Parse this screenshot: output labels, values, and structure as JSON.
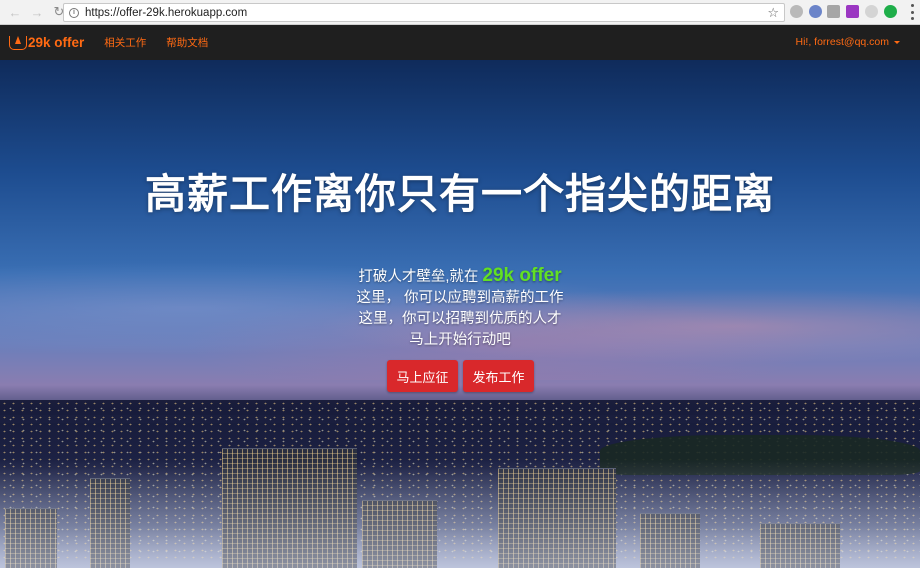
{
  "browser": {
    "url": "https://offer-29k.herokuapp.com",
    "icons": [
      "back-arrow-icon",
      "forward-arrow-icon",
      "reload-icon",
      "info-icon",
      "star-icon",
      "menu-dots-icon"
    ]
  },
  "navbar": {
    "brand": "29k offer",
    "links": [
      "相关工作",
      "帮助文档"
    ],
    "user": "Hi!, forrest@qq.com"
  },
  "hero": {
    "title": "高薪工作离你只有一个指尖的距离",
    "line1_prefix": "打破人才壁垒,就在",
    "line1_accent": "29k offer",
    "line2": "这里， 你可以应聘到高薪的工作",
    "line3": "这里，你可以招聘到优质的人才",
    "line4": "马上开始行动吧",
    "button_apply": "马上应征",
    "button_post": "发布工作"
  },
  "colors": {
    "brand_orange": "#ff6a13",
    "accent_green": "#62e023",
    "button_red": "#d9282b",
    "navbar_bg": "#1f1f1f"
  }
}
